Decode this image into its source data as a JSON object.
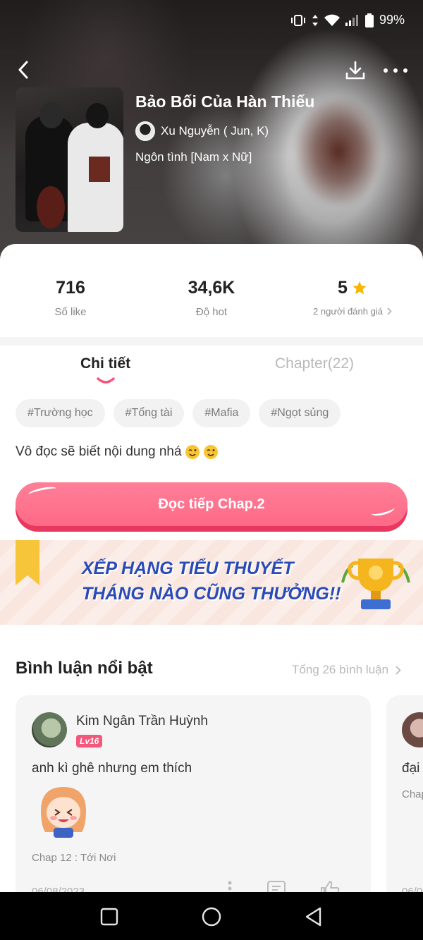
{
  "status_bar": {
    "battery": "99%"
  },
  "header": {
    "back_icon": "chevron-left-icon",
    "download_icon": "download-icon",
    "more_icon": "more-dots-icon"
  },
  "story": {
    "title": "Bảo Bối Của Hàn Thiếu",
    "author": "Xu Nguyễn ( Jun, K)",
    "genre": "Ngôn tình [Nam x Nữ]"
  },
  "stats": {
    "likes": {
      "value": "716",
      "label": "Số like"
    },
    "hot": {
      "value": "34,6K",
      "label": "Độ hot"
    },
    "rating": {
      "value": "5",
      "label": "2 người đánh giá",
      "star_color": "#f7b500"
    }
  },
  "tabs": {
    "details": "Chi tiết",
    "chapters": "Chapter(22)"
  },
  "tags": [
    "#Trường học",
    "#Tổng tài",
    "#Mafia",
    "#Ngọt sủng"
  ],
  "description": "Vô đọc sẽ biết nội dung nhá",
  "read_button": {
    "label": "Đọc tiếp Chap.2",
    "color": "#fd6a87"
  },
  "banner": {
    "line1": "XẾP HẠNG TIỂU THUYẾT",
    "line2": "THÁNG NÀO CŨNG THƯỞNG!!"
  },
  "comments": {
    "title": "Bình luận nổi bật",
    "total": "Tổng 26 bình luận",
    "items": [
      {
        "user": "Kim Ngân Trần Huỳnh",
        "level": "Lv16",
        "text": "anh kì ghê nhưng em thích",
        "chapter": "Chap 12 : Tới Nơi",
        "date": "06/08/2023"
      },
      {
        "user": "",
        "text": "đại",
        "chapter": "Chap",
        "date": "06/0"
      }
    ]
  },
  "navbar": {
    "recent": "square-icon",
    "home": "circle-icon",
    "back": "triangle-back-icon"
  }
}
